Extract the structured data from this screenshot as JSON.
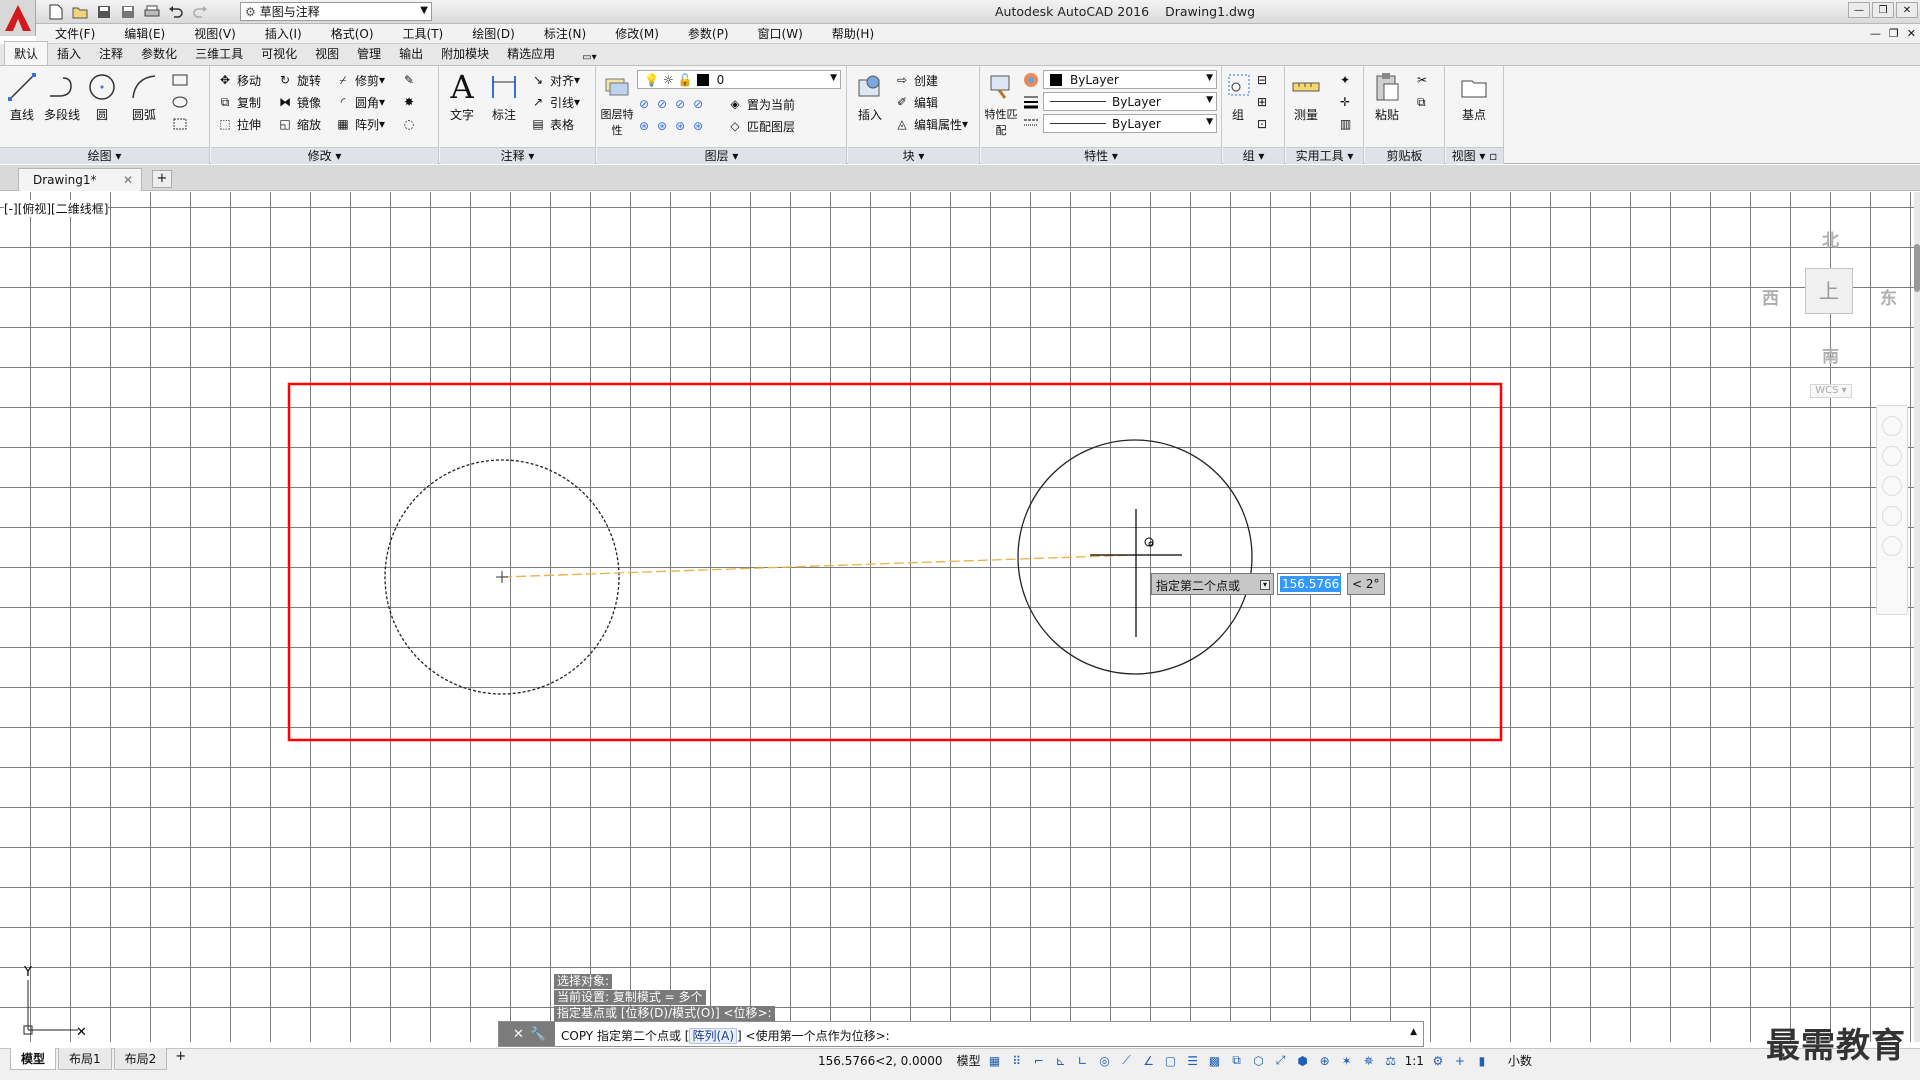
{
  "titlebar": {
    "app_name": "Autodesk AutoCAD 2016",
    "file_name": "Drawing1.dwg",
    "workspace": "草图与注释"
  },
  "menubar": {
    "items": [
      "文件(F)",
      "编辑(E)",
      "视图(V)",
      "插入(I)",
      "格式(O)",
      "工具(T)",
      "绘图(D)",
      "标注(N)",
      "修改(M)",
      "参数(P)",
      "窗口(W)",
      "帮助(H)"
    ]
  },
  "ribbon_tabs": [
    "默认",
    "插入",
    "注释",
    "参数化",
    "三维工具",
    "可视化",
    "视图",
    "管理",
    "输出",
    "附加模块",
    "精选应用"
  ],
  "ribbon": {
    "draw": {
      "title": "绘图",
      "line": "直线",
      "polyline": "多段线",
      "circle": "圆",
      "arc": "圆弧"
    },
    "modify": {
      "title": "修改",
      "move": "移动",
      "rotate": "旋转",
      "trim": "修剪",
      "copy": "复制",
      "mirror": "镜像",
      "fillet": "圆角",
      "stretch": "拉伸",
      "scale": "缩放",
      "array": "阵列"
    },
    "annotation": {
      "title": "注释",
      "text": "文字",
      "dimension": "标注",
      "align": "对齐",
      "leader": "引线",
      "table": "表格"
    },
    "layers": {
      "title": "图层",
      "layer_props": "图层特性",
      "layer_value": "0",
      "set_current": "置为当前",
      "match_layer": "匹配图层"
    },
    "block": {
      "title": "块",
      "insert": "插入",
      "create": "创建",
      "edit": "编辑",
      "edit_attr": "编辑属性"
    },
    "properties": {
      "title": "特性",
      "match": "特性匹配",
      "color": "ByLayer",
      "linetype": "ByLayer",
      "lineweight": "ByLayer"
    },
    "groups": {
      "title": "组",
      "group": "组"
    },
    "utilities": {
      "title": "实用工具",
      "measure": "测量"
    },
    "clipboard": {
      "title": "剪贴板",
      "paste": "粘贴"
    },
    "view": {
      "title": "视图",
      "base": "基点"
    }
  },
  "file_tab": {
    "name": "Drawing1*"
  },
  "drawing": {
    "viewport_label": "[-][俯视][二维线框]",
    "viewcube": {
      "north": "北",
      "south": "南",
      "east": "东",
      "west": "西",
      "wcs": "WCS"
    }
  },
  "dynamic_input": {
    "prompt": "指定第二个点或",
    "distance": "156.5766",
    "angle": "< 2°"
  },
  "command": {
    "history": [
      "选择对象:",
      "当前设置:  复制模式 = 多个",
      "指定基点或 [位移(D)/模式(O)] <位移>:"
    ],
    "current_prefix": "COPY 指定第二个点或 [",
    "current_option": "阵列(A)",
    "current_suffix": "] <使用第一个点作为位移>:"
  },
  "layout_tabs": [
    "模型",
    "布局1",
    "布局2"
  ],
  "statusbar": {
    "coordinates": "156.5766<2, 0.0000",
    "space": "模型",
    "scale": "1:1",
    "units": "小数"
  },
  "watermark": "最需教育",
  "colors": {
    "highlight_box": "#ff0000",
    "rubber_band": "#e8b24a",
    "selection": "#3399ff"
  }
}
